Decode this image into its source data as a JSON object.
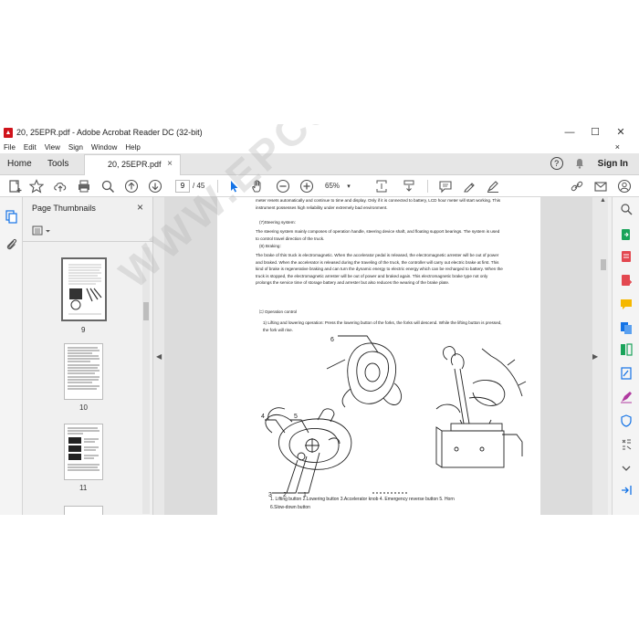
{
  "window": {
    "title": "20, 25EPR.pdf - Adobe Acrobat Reader DC (32-bit)",
    "controls": [
      "—",
      "☐",
      "✕"
    ]
  },
  "menu": {
    "items": [
      "File",
      "Edit",
      "View",
      "Sign",
      "Window",
      "Help"
    ],
    "close": "×"
  },
  "tabs": {
    "home": "Home",
    "tools": "Tools",
    "document": "20, 25EPR.pdf",
    "close": "×",
    "sign_in": "Sign In"
  },
  "toolbar": {
    "current_page": "9",
    "page_total": "/ 45",
    "zoom": "65%"
  },
  "thumbnails": {
    "title": "Page Thumbnails",
    "close": "×",
    "pages": [
      "9",
      "10",
      "11"
    ]
  },
  "document": {
    "paragraphs": [
      "meter resets automatically and continue to time and display. Only if it is connected to battery, LCD hour meter will start working. This instrument possesses high reliability under extremely bad environment.",
      "(7)Steering system:",
      "The steering system mainly composes of operation handle, steering device shaft, and floating support bearings. The system is used to control travel direction of the truck.",
      "(8) Braking:",
      "The brake of this truck is electromagnetic. When the accelerator pedal is released, the electromagnetic arrester will be out of power and braked. When the accelerator is released during the traveling of the truck, the controller will carry out electric brake at first. This kind of brake is regenerative braking and can turn the dynamic energy to electric energy which can be recharged to battery. When the truck is stopped, the electromagnetic arrester will be out of power and braked again. This electromagnetic brake type not only prolongs the service time of storage battery and arrester but also reduces the wearing of the brake plate.",
      "㈡ Operation control",
      "1)    Lifting and lowering operation: Press the lowering button of the forks, the forks will descend. While the lifting button is pressed, the fork will rise."
    ],
    "callouts": [
      "6",
      "4",
      "5",
      "3",
      "2",
      "1"
    ],
    "caption_line1": "1. Lifting button   2.Lowering button   3.Accelerator knob   4. Emergency reverse button   5. Horn",
    "caption_line2": "6.Slow-down button",
    "watermark": "WWW.EPCSERVICE"
  }
}
